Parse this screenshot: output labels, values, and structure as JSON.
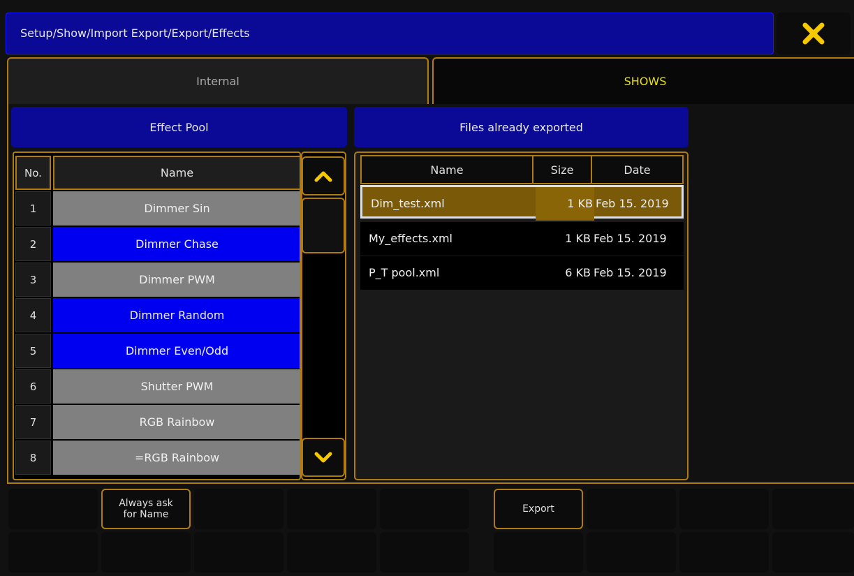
{
  "window": {
    "title": "Setup/Show/Import Export/Export/Effects"
  },
  "tabs": [
    {
      "label": "Internal",
      "active": false
    },
    {
      "label": "SHOWS",
      "active": true
    }
  ],
  "effect_pool": {
    "header": "Effect Pool",
    "columns": {
      "no": "No.",
      "name": "Name"
    },
    "rows": [
      {
        "no": "1",
        "name": "Dimmer Sin",
        "color": "grey"
      },
      {
        "no": "2",
        "name": "Dimmer Chase",
        "color": "blue"
      },
      {
        "no": "3",
        "name": "Dimmer PWM",
        "color": "grey"
      },
      {
        "no": "4",
        "name": "Dimmer Random",
        "color": "blue"
      },
      {
        "no": "5",
        "name": "Dimmer Even/Odd",
        "color": "blue"
      },
      {
        "no": "6",
        "name": "Shutter PWM",
        "color": "grey"
      },
      {
        "no": "7",
        "name": "RGB Rainbow",
        "color": "grey"
      },
      {
        "no": "8",
        "name": "=RGB Rainbow",
        "color": "grey"
      }
    ]
  },
  "exported_files": {
    "header": "Files already exported",
    "columns": {
      "name": "Name",
      "size": "Size",
      "date": "Date"
    },
    "rows": [
      {
        "name": "Dim_test.xml",
        "size": "1 KB",
        "date": "Feb 15. 2019",
        "selected": true
      },
      {
        "name": "My_effects.xml",
        "size": "1 KB",
        "date": "Feb 15. 2019",
        "selected": false
      },
      {
        "name": "P_T pool.xml",
        "size": "6 KB",
        "date": "Feb 15. 2019",
        "selected": false
      }
    ]
  },
  "buttons": {
    "always_ask": "Always ask\nfor Name",
    "export": "Export"
  },
  "colors": {
    "accent_border": "#b07c12",
    "header_blue": "#0a0a96",
    "row_blue": "#0000f0",
    "row_grey": "#808080",
    "active_tab_text": "#e8e000",
    "close_icon": "#f5c800"
  }
}
